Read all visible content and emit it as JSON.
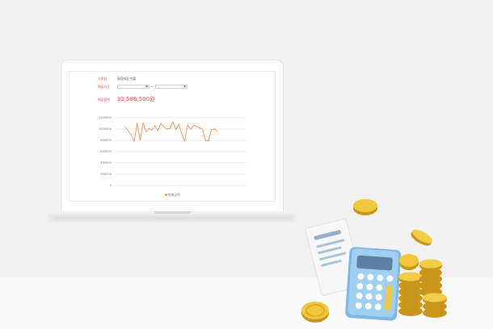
{
  "filters": {
    "store_label": "가맹점",
    "store_value": "통합매장 현황",
    "period_label": "매출기간",
    "date_separator": "~",
    "calendar_icon": "calendar-icon"
  },
  "summary": {
    "total_label": "매출합계",
    "total_value": "32,586,500원"
  },
  "chart_data": {
    "type": "line",
    "title": "",
    "xlabel": "",
    "ylabel": "",
    "ylim": [
      0,
      1200000
    ],
    "yticks": [
      0,
      200000,
      400000,
      600000,
      800000,
      1000000,
      1200000
    ],
    "ytick_labels": [
      "0",
      "200000",
      "400000",
      "600000",
      "800000",
      "1000000",
      "1200000"
    ],
    "grid": true,
    "legend_position": "bottom",
    "series": [
      {
        "name": "판매금액",
        "color": "#e8955a",
        "values": [
          1040000,
          960000,
          900000,
          780000,
          1100000,
          800000,
          1110000,
          950000,
          1010000,
          980000,
          1060000,
          970000,
          1100000,
          1040000,
          1000000,
          1010000,
          1120000,
          990000,
          1080000,
          920000,
          790000,
          1070000,
          1000000,
          1060000,
          1050000,
          1020000,
          1000000,
          800000,
          790000,
          990000,
          1000000,
          960000
        ]
      }
    ]
  },
  "colors": {
    "accent_red": "#e24a4a",
    "line_orange": "#e8955a",
    "calculator_blue": "#8fc4ea",
    "coin_gold": "#e6b828"
  }
}
